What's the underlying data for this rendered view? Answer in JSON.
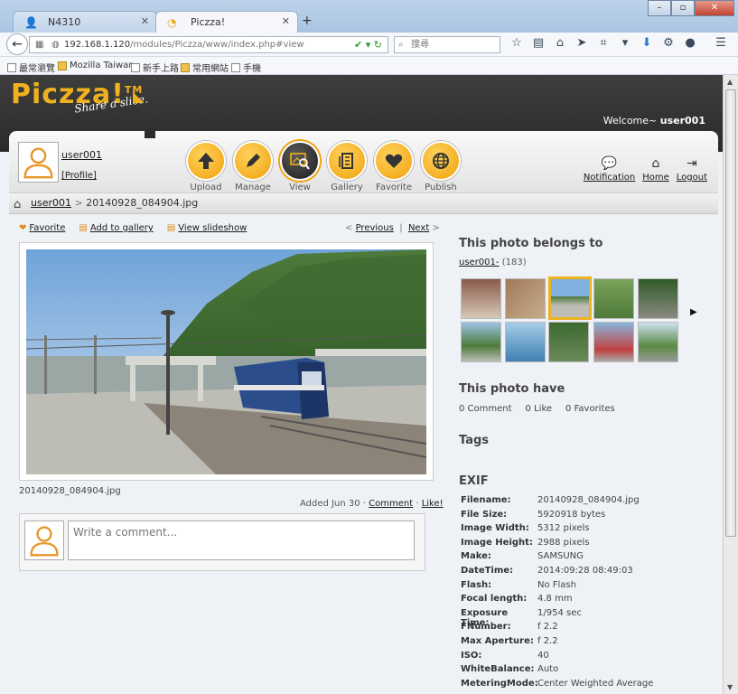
{
  "browser": {
    "tabs": [
      {
        "label": "N4310"
      },
      {
        "label": "Piczza!"
      }
    ],
    "url_host": "192.168.1.120",
    "url_path": "/modules/Piczza/www/index.php#view",
    "search_placeholder": "搜尋",
    "bookmarks": [
      "最常瀏覽",
      "Mozilla Taiwan",
      "新手上路",
      "常用網站",
      "手機"
    ]
  },
  "site": {
    "logo": "Piczza!",
    "logo_tm": "TM",
    "tagline": "Share a slice.",
    "welcome_prefix": "Welcome~",
    "welcome_user": "user001",
    "user": {
      "name": "user001",
      "profile": "[Profile]"
    },
    "actions": [
      {
        "label": "Upload",
        "icon": "upload-icon"
      },
      {
        "label": "Manage",
        "icon": "pencil-icon"
      },
      {
        "label": "View",
        "icon": "view-photo-icon",
        "active": true
      },
      {
        "label": "Gallery",
        "icon": "gallery-icon"
      },
      {
        "label": "Favorite",
        "icon": "heart-icon"
      },
      {
        "label": "Publish",
        "icon": "globe-icon"
      }
    ],
    "toplinks": {
      "notification": "Notification",
      "home": "Home",
      "logout": "Logout"
    },
    "breadcrumb": {
      "user": "user001",
      "sep": ">",
      "current": "20140928_084904.jpg"
    },
    "tools": {
      "favorite": "Favorite",
      "add_gallery": "Add to gallery",
      "slideshow": "View slideshow"
    },
    "nav": {
      "prev_arrow": "<",
      "previous": "Previous",
      "divider": "|",
      "next": "Next",
      "next_arrow": ">"
    },
    "photo_name": "20140928_084904.jpg",
    "added": {
      "text": "Added Jun 30 ·",
      "comment": "Comment",
      "dot": "·",
      "like": "Like!"
    },
    "comment_placeholder": "Write a comment...",
    "belongs": {
      "title": "This photo belongs to",
      "gallery": "user001-",
      "count": "(183)"
    },
    "have": {
      "title": "This photo have",
      "comments": "0 Comment",
      "likes": "0 Like",
      "favorites": "0 Favorites"
    },
    "tags_title": "Tags",
    "exif_title": "EXIF",
    "exif": [
      {
        "k": "Filename:",
        "v": "20140928_084904.jpg"
      },
      {
        "k": "File Size:",
        "v": "5920918 bytes"
      },
      {
        "k": "Image Width:",
        "v": "5312 pixels"
      },
      {
        "k": "Image Height:",
        "v": "2988 pixels"
      },
      {
        "k": "Make:",
        "v": "SAMSUNG"
      },
      {
        "k": "DateTime:",
        "v": "2014:09:28 08:49:03"
      },
      {
        "k": "Flash:",
        "v": "No Flash"
      },
      {
        "k": "Focal length:",
        "v": "4.8 mm"
      },
      {
        "k": "Exposure Time:",
        "v": "1/954 sec"
      },
      {
        "k": "FNumber:",
        "v": "f 2.2"
      },
      {
        "k": "Max Aperture:",
        "v": "f 2.2"
      },
      {
        "k": "ISO:",
        "v": "40"
      },
      {
        "k": "WhiteBalance:",
        "v": "Auto"
      },
      {
        "k": "MeteringMode:",
        "v": "Center Weighted Average"
      }
    ],
    "accent": "#f0b11f"
  }
}
